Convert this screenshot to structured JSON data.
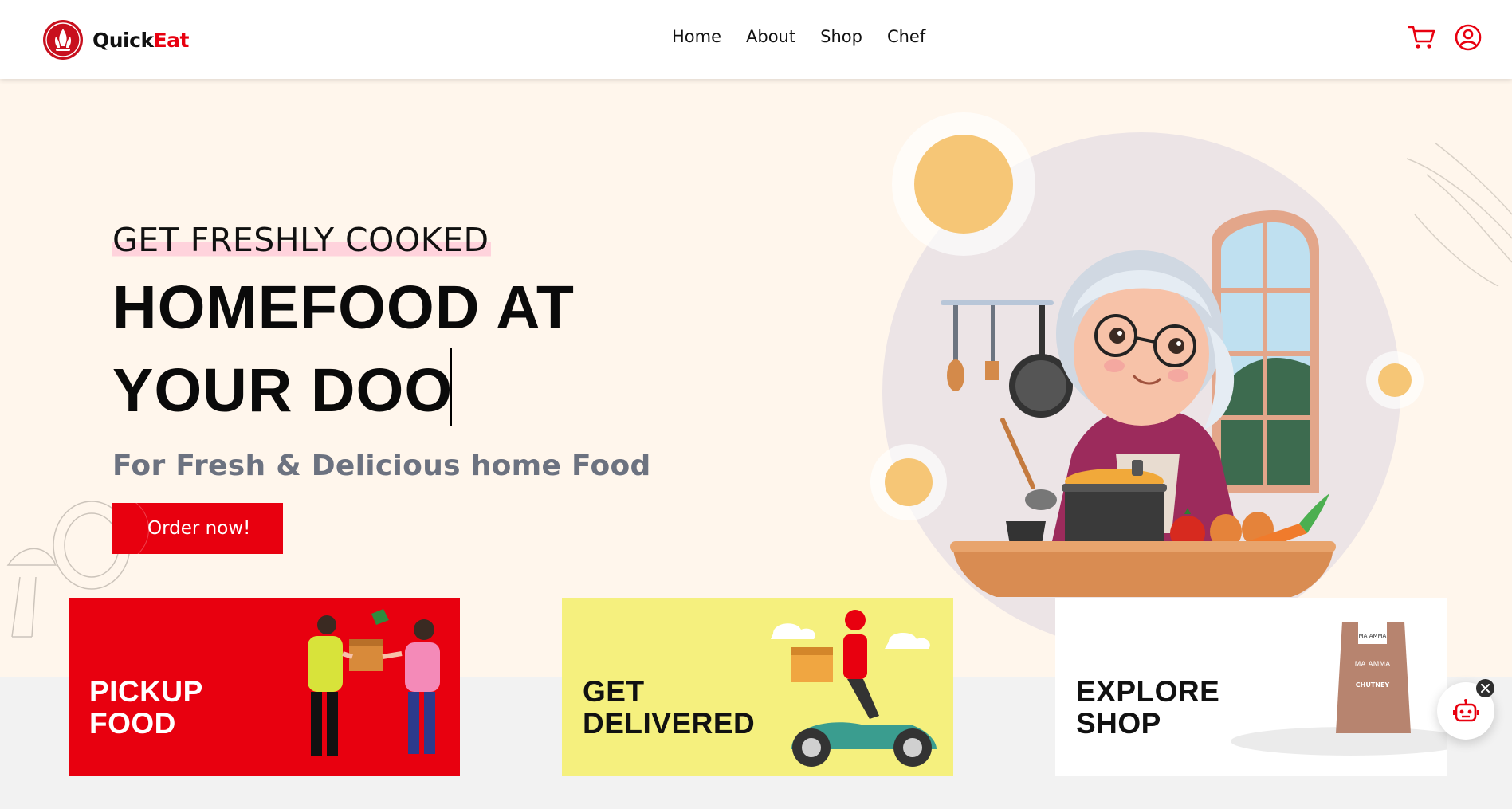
{
  "brand": {
    "name_part1": "Quick",
    "name_part2": "Eat",
    "logo_icon": "chef-flame-logo-icon"
  },
  "nav": {
    "links": [
      {
        "label": "Home"
      },
      {
        "label": "About"
      },
      {
        "label": "Shop"
      },
      {
        "label": "Chef"
      }
    ],
    "icons": [
      "cart-icon",
      "user-account-icon"
    ]
  },
  "hero": {
    "tagline": "GET FRESHLY COOKED",
    "heading_line1": "HOMEFOOD AT",
    "heading_line2": "YOUR DOO",
    "subheading": "For Fresh & Delicious home Food",
    "cta_label": "Order now!",
    "illustration": "grandmother-cooking-illustration"
  },
  "cards": [
    {
      "title_line1": "PICKUP",
      "title_line2": "FOOD",
      "bg": "#e8000f",
      "text_color": "#ffffff",
      "art": "food-handover-illustration"
    },
    {
      "title_line1": "GET",
      "title_line2": "DELIVERED",
      "bg": "#f5f07e",
      "text_color": "#111111",
      "art": "scooter-delivery-illustration"
    },
    {
      "title_line1": "EXPLORE",
      "title_line2": "SHOP",
      "bg": "#ffffff",
      "text_color": "#111111",
      "art": "chutney-pouch-product",
      "pouch_label": "MA AMMA",
      "pouch_product": "CHUTNEY"
    }
  ],
  "chat_widget": {
    "icon": "robot-icon",
    "close_icon": "close-icon"
  },
  "colors": {
    "accent": "#e8000f",
    "hero_bg": "#fff6ec",
    "card_yellow": "#f5f07e",
    "text_gray": "#6c7280"
  }
}
